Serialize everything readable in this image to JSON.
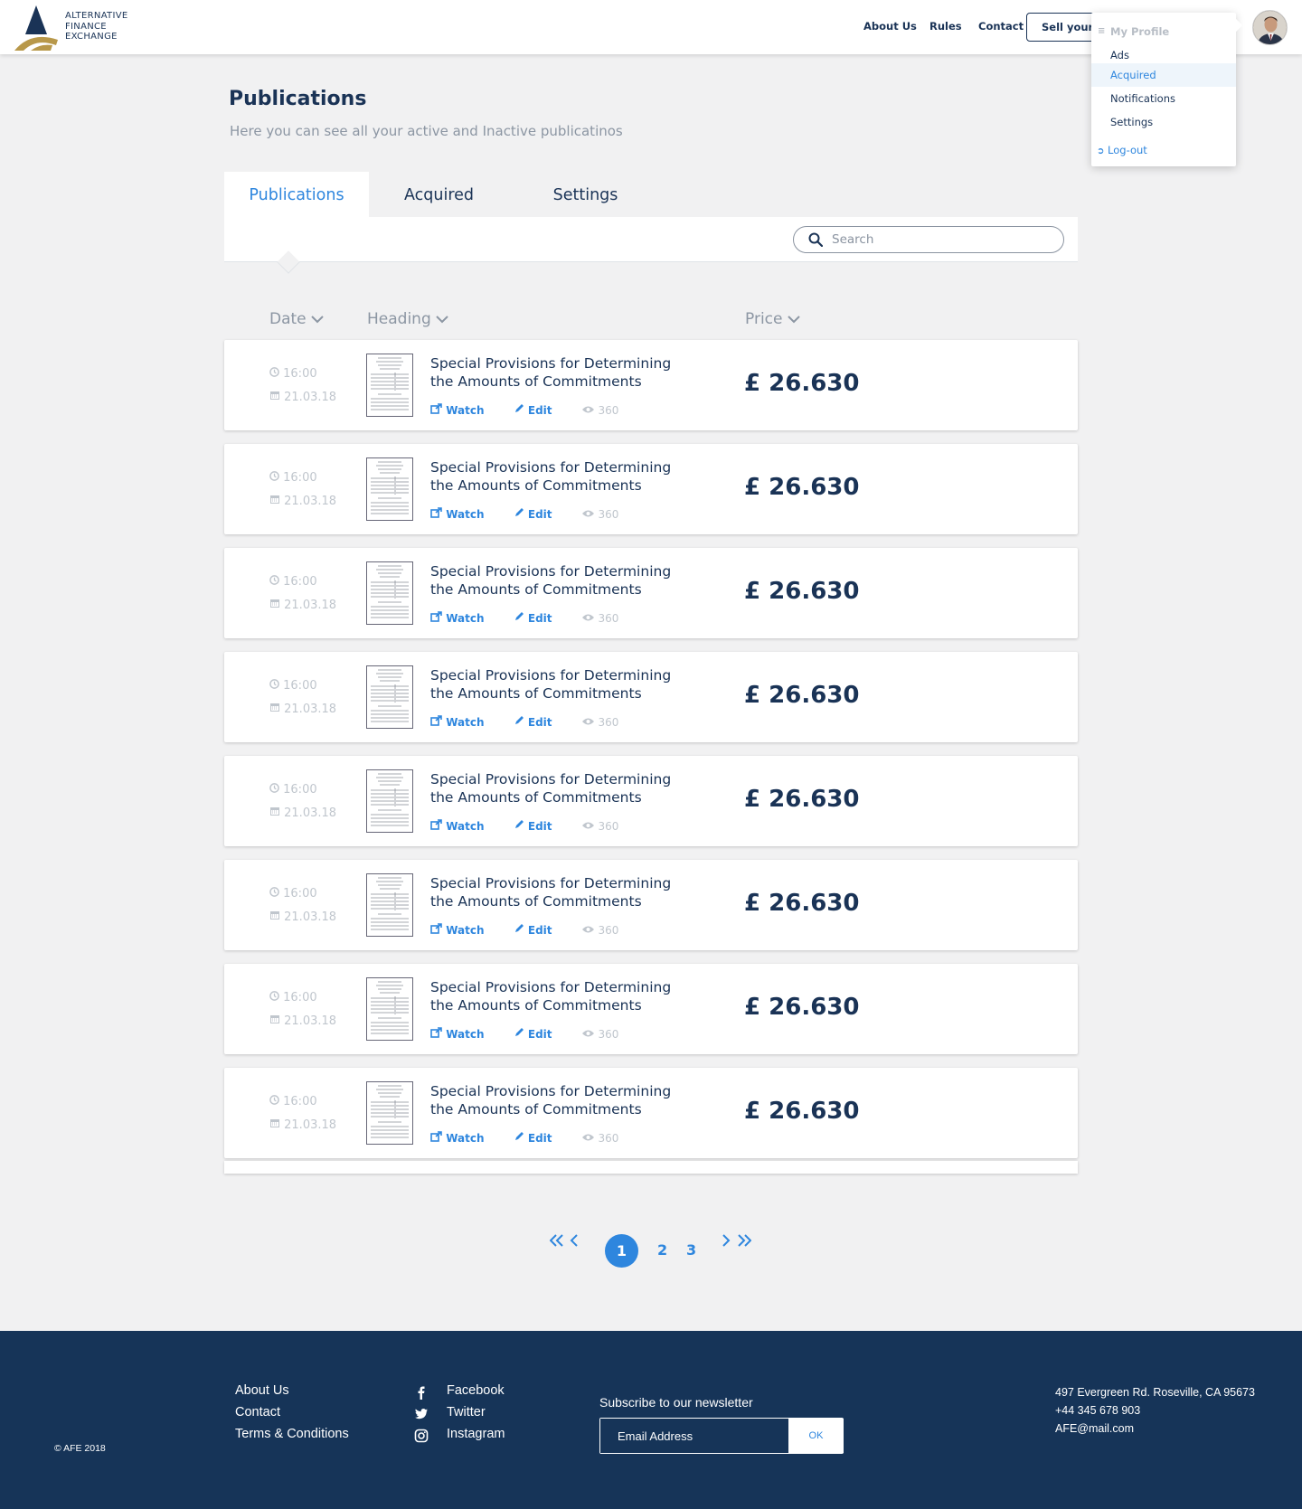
{
  "brand": {
    "logo_line1": "ALTERNATIVE",
    "logo_line2": "FINANCE",
    "logo_line3": "EXCHANGE",
    "accent": "#2e86de",
    "navy": "#1a3356",
    "gold": "#b8984a"
  },
  "nav": {
    "about": "About Us",
    "rules": "Rules",
    "contact": "Contact",
    "sell": "Sell your l"
  },
  "profile_menu": {
    "header": "My Profile",
    "items": [
      "Ads",
      "Acquired",
      "Notifications",
      "Settings"
    ],
    "active": "Acquired",
    "logout": "Log-out"
  },
  "page": {
    "title": "Publications",
    "subtitle": "Here you can see all your active and Inactive publicatinos"
  },
  "tabs": [
    "Publications",
    "Acquired",
    "Settings"
  ],
  "active_tab": "Publications",
  "search": {
    "placeholder": "Search",
    "value": ""
  },
  "columns": {
    "date": "Date",
    "heading": "Heading",
    "price": "Price"
  },
  "rows": [
    {
      "time": "16:00",
      "date": "21.03.18",
      "title": "Special Provisions for Determining the Amounts of Commitments",
      "watch": "Watch",
      "edit": "Edit",
      "views": "360",
      "price": "£ 26.630"
    },
    {
      "time": "16:00",
      "date": "21.03.18",
      "title": "Special Provisions for Determining the Amounts of Commitments",
      "watch": "Watch",
      "edit": "Edit",
      "views": "360",
      "price": "£ 26.630"
    },
    {
      "time": "16:00",
      "date": "21.03.18",
      "title": "Special Provisions for Determining the Amounts of Commitments",
      "watch": "Watch",
      "edit": "Edit",
      "views": "360",
      "price": "£ 26.630"
    },
    {
      "time": "16:00",
      "date": "21.03.18",
      "title": "Special Provisions for Determining the Amounts of Commitments",
      "watch": "Watch",
      "edit": "Edit",
      "views": "360",
      "price": "£ 26.630"
    },
    {
      "time": "16:00",
      "date": "21.03.18",
      "title": "Special Provisions for Determining the Amounts of Commitments",
      "watch": "Watch",
      "edit": "Edit",
      "views": "360",
      "price": "£ 26.630"
    },
    {
      "time": "16:00",
      "date": "21.03.18",
      "title": "Special Provisions for Determining the Amounts of Commitments",
      "watch": "Watch",
      "edit": "Edit",
      "views": "360",
      "price": "£ 26.630"
    },
    {
      "time": "16:00",
      "date": "21.03.18",
      "title": "Special Provisions for Determining the Amounts of Commitments",
      "watch": "Watch",
      "edit": "Edit",
      "views": "360",
      "price": "£ 26.630"
    },
    {
      "time": "16:00",
      "date": "21.03.18",
      "title": "Special Provisions for Determining the Amounts of Commitments",
      "watch": "Watch",
      "edit": "Edit",
      "views": "360",
      "price": "£ 26.630"
    }
  ],
  "pagination": {
    "current": "1",
    "pages": [
      "2",
      "3"
    ]
  },
  "footer": {
    "links": [
      "About Us",
      "Contact",
      "Terms & Conditions"
    ],
    "social": [
      "Facebook",
      "Twitter",
      "Instagram"
    ],
    "newsletter": "Subscribe to our newsletter",
    "email_placeholder": "Email Address",
    "ok": "OK",
    "address": "497 Evergreen Rd. Roseville, CA 95673",
    "phone": "+44 345 678 903",
    "email": "AFE@mail.com",
    "copyright": "AFE 2018"
  }
}
